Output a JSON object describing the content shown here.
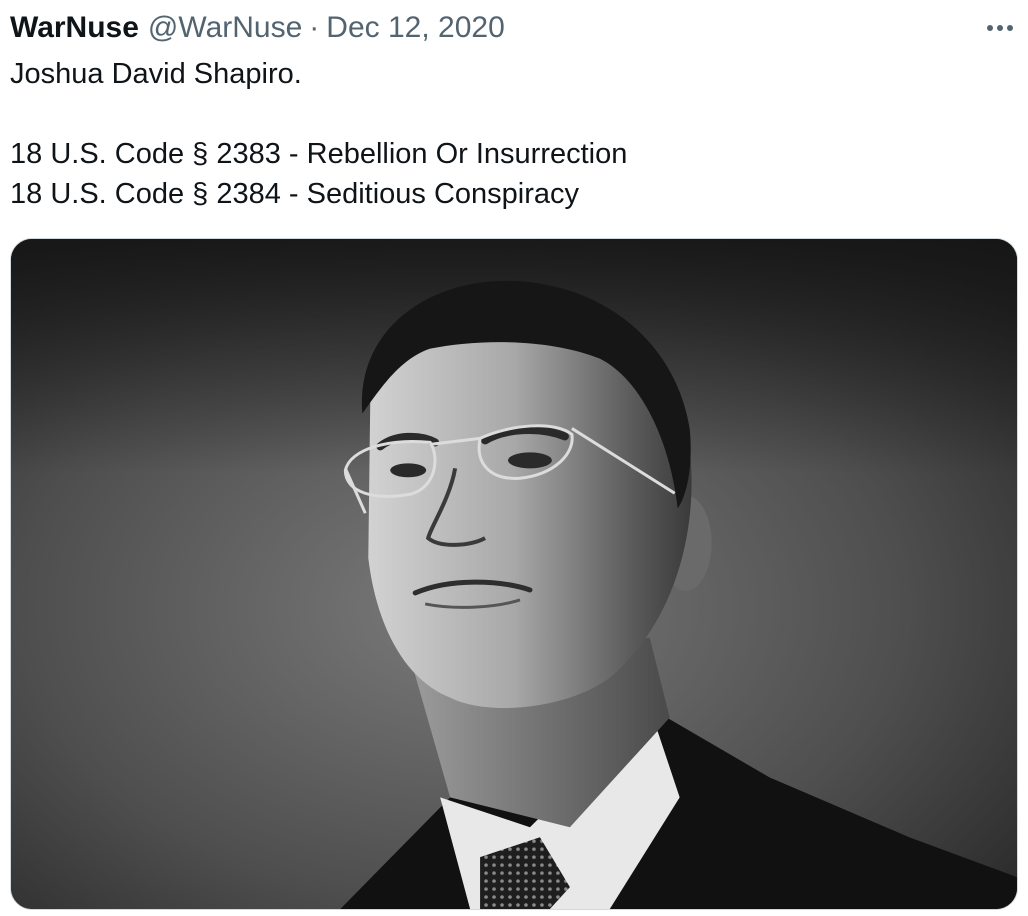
{
  "tweet": {
    "display_name": "WarNuse",
    "handle": "@WarNuse",
    "separator": "·",
    "date": "Dec 12, 2020",
    "text_lines": [
      "Joshua David Shapiro.",
      "",
      "18 U.S. Code § 2383 - Rebellion Or Insurrection",
      "18 U.S. Code § 2384 - Seditious Conspiracy"
    ],
    "more_icon": "ellipsis-icon"
  },
  "media": {
    "type": "photo",
    "style": "black-and-white portrait"
  }
}
